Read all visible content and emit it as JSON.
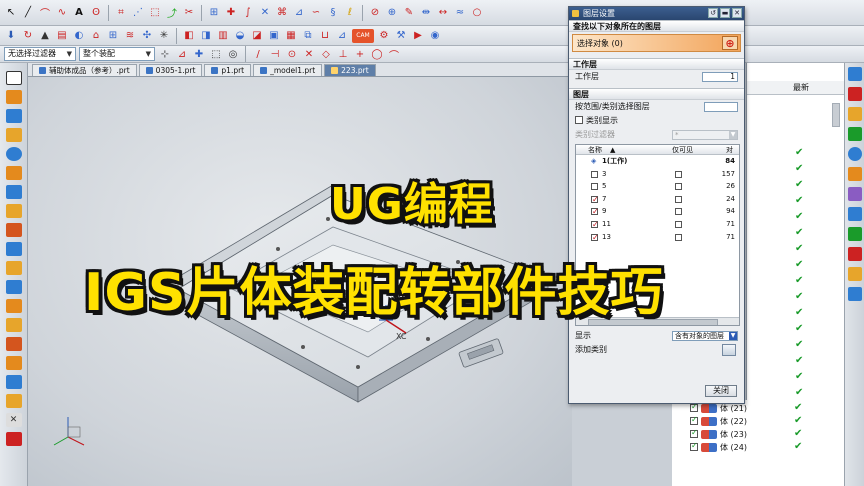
{
  "toolbar": {
    "filter_combo": "无选择过滤器",
    "assembly_combo": "整个装配"
  },
  "tabs": [
    {
      "label": "辅助体成品（参考）.prt",
      "active": false
    },
    {
      "label": "0305-1.prt",
      "active": false
    },
    {
      "label": "p1.prt",
      "active": false
    },
    {
      "label": "_model1.prt",
      "active": false
    },
    {
      "label": "223.prt",
      "active": true
    }
  ],
  "caption": {
    "line1": "UG编程",
    "line2": "IGS片体装配转部件技巧"
  },
  "viewport": {
    "csys_label": "XC"
  },
  "dialog": {
    "title": "图层设置",
    "section_find": "查找以下对象所在的图层",
    "select_object": "选择对象 (0)",
    "section_work": "工作层",
    "work_layer_label": "工作层",
    "work_layer_value": "1",
    "section_layers": "图层",
    "range_label": "按范围/类别选择图层",
    "category_display": "类别显示",
    "category_filter": "类别过滤器",
    "category_filter_value": "*",
    "col_name": "名称",
    "col_visible": "仅可见",
    "col_count": "对",
    "layers": [
      {
        "name": "1(工作)",
        "count": "84",
        "checked": true,
        "work": true
      },
      {
        "name": "3",
        "count": "157",
        "checked": false
      },
      {
        "name": "5",
        "count": "26",
        "checked": false
      },
      {
        "name": "7",
        "count": "24",
        "checked": true
      },
      {
        "name": "9",
        "count": "94",
        "checked": true
      },
      {
        "name": "11",
        "count": "71",
        "checked": true
      },
      {
        "name": "13",
        "count": "71",
        "checked": true
      }
    ],
    "display_label": "显示",
    "display_value": "含有对象的图层",
    "add_category": "添加类别",
    "close_button": "关闭"
  },
  "navigator": {
    "col_latest": "最新",
    "bodies": [
      {
        "label": "体 (21)"
      },
      {
        "label": "体 (22)"
      },
      {
        "label": "体 (23)"
      },
      {
        "label": "体 (24)"
      }
    ]
  },
  "colors": {
    "caption_fill": "#ffe100",
    "caption_outline": "#111111",
    "title_bar": "#2a4670",
    "select_highlight": "#f2a45a",
    "check_green": "#1a9b2a"
  }
}
